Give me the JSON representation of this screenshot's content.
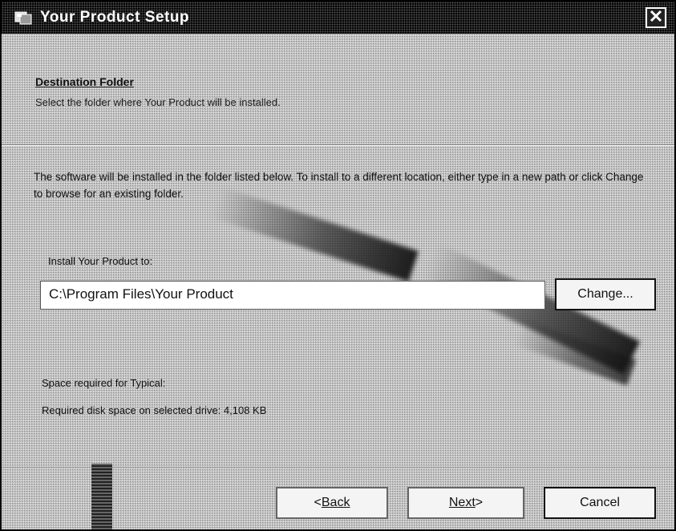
{
  "window": {
    "title": "Your Product Setup",
    "icon": "setup-icon",
    "close_icon": "close-icon"
  },
  "header": {
    "title": "Destination Folder",
    "subtitle": "Select the folder where Your Product will be installed."
  },
  "main": {
    "description": "The software will be installed in the folder listed below. To install to a different location, either type in a new path or click Change to browse for an existing folder.",
    "install_label": "Install Your Product to:",
    "install_path": "C:\\Program Files\\Your Product",
    "change_label": "Change...",
    "space_label": "Space required for Typical:",
    "space_value": "Required disk space on selected drive: 4,108 KB"
  },
  "footer": {
    "back_prefix": "< ",
    "back_label": "Back",
    "next_label": "Next",
    "next_suffix": " >",
    "cancel_label": "Cancel"
  }
}
